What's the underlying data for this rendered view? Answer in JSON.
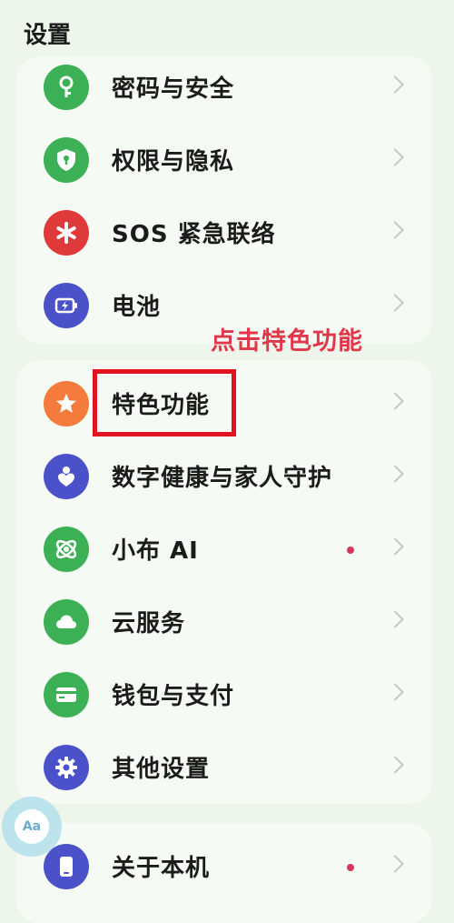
{
  "header": {
    "title": "设置"
  },
  "colors": {
    "green": "#3bb055",
    "red": "#e0393a",
    "indigo": "#4b52c9",
    "orange": "#f47b3c",
    "annotation": "#e0384a",
    "highlight_border": "#e2141f"
  },
  "group1": [
    {
      "label": "密码与安全",
      "icon": "key-icon"
    },
    {
      "label": "权限与隐私",
      "icon": "shield-icon"
    },
    {
      "label": "SOS 紧急联络",
      "icon": "asterisk-icon"
    },
    {
      "label": "电池",
      "icon": "battery-icon"
    }
  ],
  "annotation": {
    "text": "点击特色功能"
  },
  "group2": [
    {
      "label": "特色功能",
      "icon": "star-icon"
    },
    {
      "label": "数字健康与家人守护",
      "icon": "heart-person-icon"
    },
    {
      "label": "小布 AI",
      "icon": "orbit-icon",
      "badge": true
    },
    {
      "label": "云服务",
      "icon": "cloud-icon"
    },
    {
      "label": "钱包与支付",
      "icon": "card-icon"
    },
    {
      "label": "其他设置",
      "icon": "gear-icon"
    }
  ],
  "group3": [
    {
      "label": "关于本机",
      "icon": "phone-icon",
      "badge": true
    }
  ],
  "float_button": {
    "text": "Aa"
  }
}
